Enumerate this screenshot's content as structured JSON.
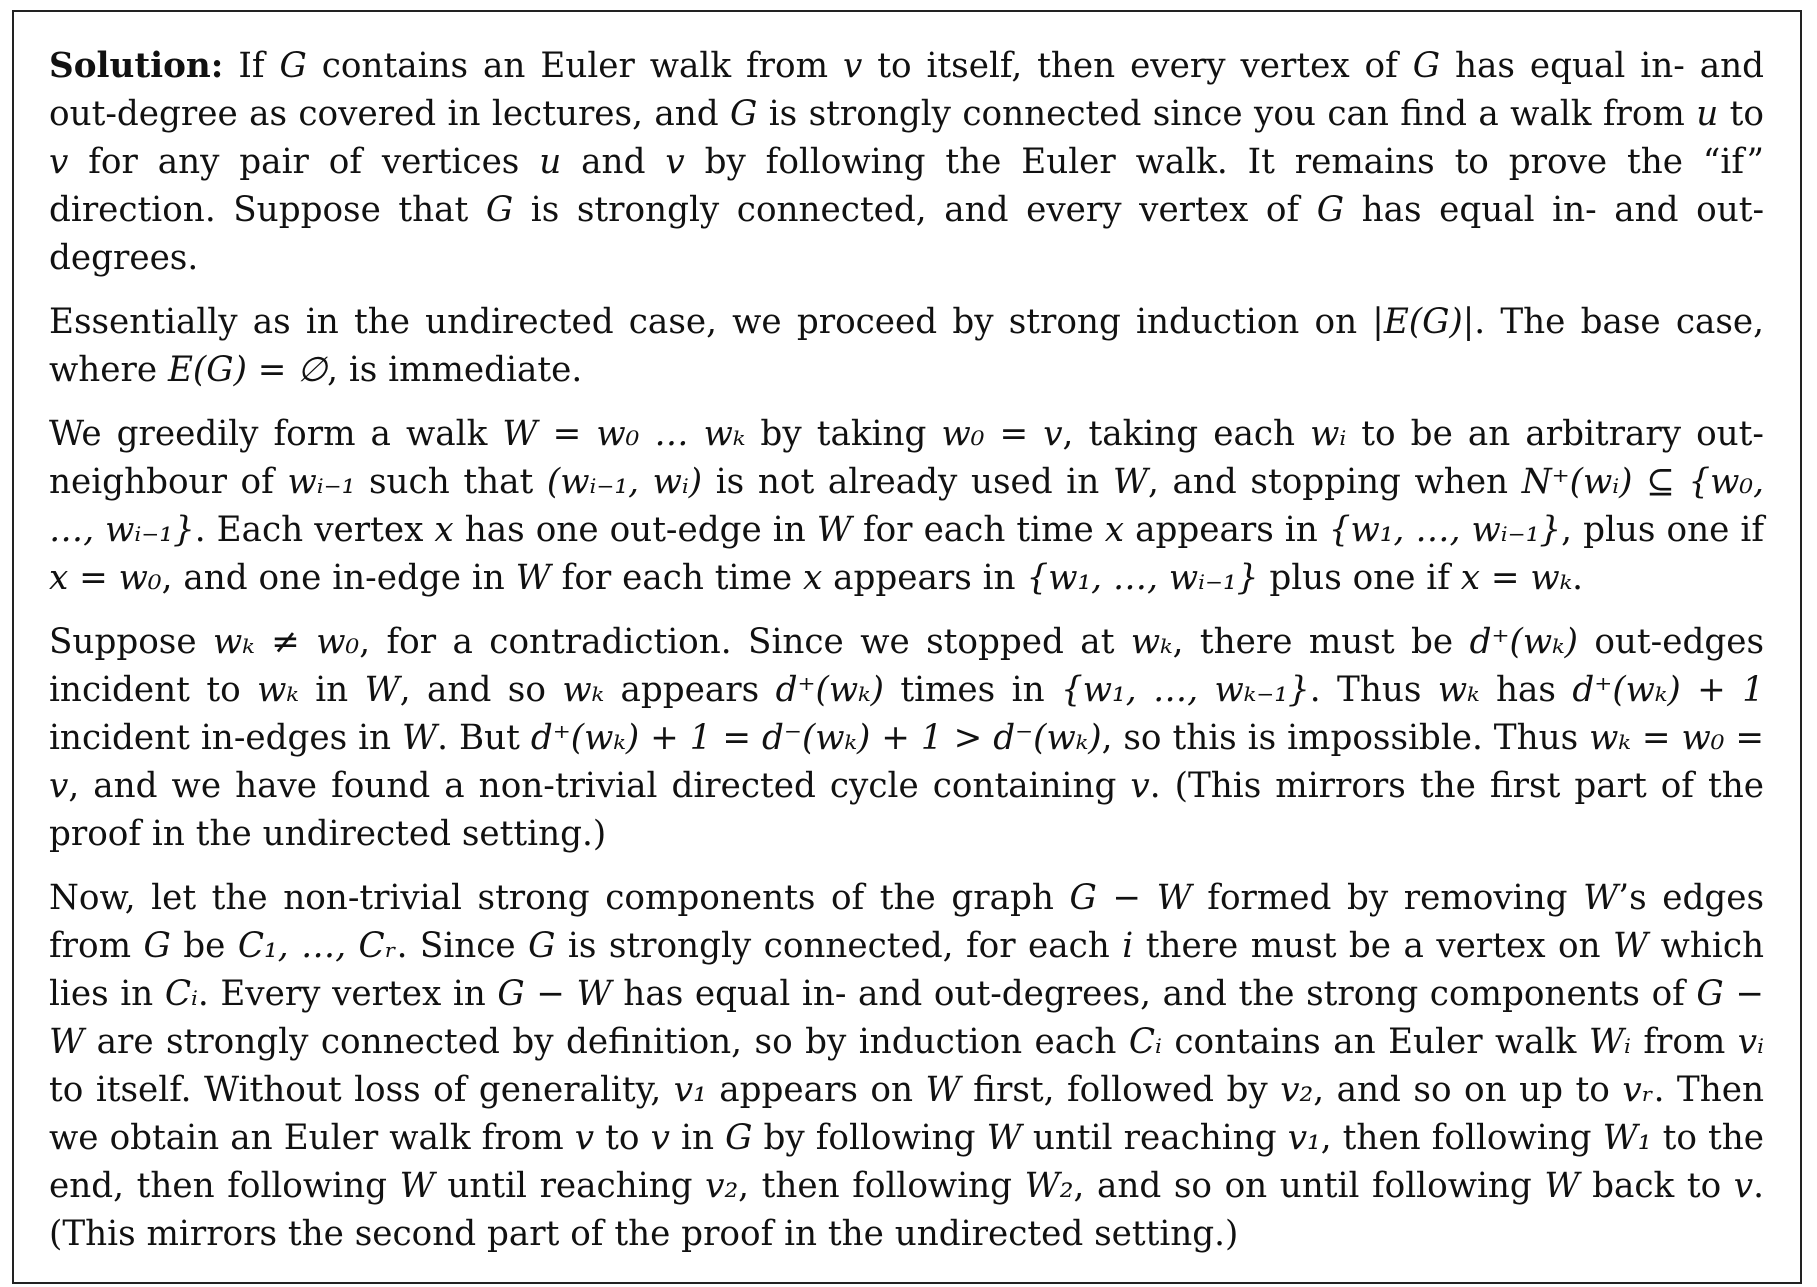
{
  "document": {
    "paragraphs": [
      {
        "segments": [
          {
            "text": "Solution:",
            "style": "bold"
          },
          {
            "text": " If ",
            "style": "normal"
          },
          {
            "text": "G",
            "style": "math"
          },
          {
            "text": " contains an Euler walk from ",
            "style": "normal"
          },
          {
            "text": "v",
            "style": "math"
          },
          {
            "text": " to itself, then every vertex of ",
            "style": "normal"
          },
          {
            "text": "G",
            "style": "math"
          },
          {
            "text": " has equal in- and out-degree as covered in lectures, and ",
            "style": "normal"
          },
          {
            "text": "G",
            "style": "math"
          },
          {
            "text": " is strongly connected since you can find a walk from ",
            "style": "normal"
          },
          {
            "text": "u",
            "style": "math"
          },
          {
            "text": " to ",
            "style": "normal"
          },
          {
            "text": "v",
            "style": "math"
          },
          {
            "text": " for any pair of vertices ",
            "style": "normal"
          },
          {
            "text": "u",
            "style": "math"
          },
          {
            "text": " and ",
            "style": "normal"
          },
          {
            "text": "v",
            "style": "math"
          },
          {
            "text": " by following the Euler walk. It remains to prove the “if” direction. Suppose that ",
            "style": "normal"
          },
          {
            "text": "G",
            "style": "math"
          },
          {
            "text": " is strongly connected, and every vertex of ",
            "style": "normal"
          },
          {
            "text": "G",
            "style": "math"
          },
          {
            "text": " has equal in- and out-degrees.",
            "style": "normal"
          }
        ]
      },
      {
        "segments": [
          {
            "text": "Essentially as in the undirected case, we proceed by strong induction on ",
            "style": "normal"
          },
          {
            "text": "|E(G)|",
            "style": "math"
          },
          {
            "text": ". The base case, where ",
            "style": "normal"
          },
          {
            "text": "E(G) = ∅",
            "style": "math"
          },
          {
            "text": ", is immediate.",
            "style": "normal"
          }
        ]
      },
      {
        "segments": [
          {
            "text": "We greedily form a walk ",
            "style": "normal"
          },
          {
            "text": "W = w₀ … wₖ",
            "style": "math"
          },
          {
            "text": " by taking ",
            "style": "normal"
          },
          {
            "text": "w₀ = v",
            "style": "math"
          },
          {
            "text": ", taking each ",
            "style": "normal"
          },
          {
            "text": "wᵢ",
            "style": "math"
          },
          {
            "text": " to be an arbitrary out-neighbour of ",
            "style": "normal"
          },
          {
            "text": "wᵢ₋₁",
            "style": "math"
          },
          {
            "text": " such that ",
            "style": "normal"
          },
          {
            "text": "(wᵢ₋₁, wᵢ)",
            "style": "math"
          },
          {
            "text": " is not already used in ",
            "style": "normal"
          },
          {
            "text": "W",
            "style": "math"
          },
          {
            "text": ", and stopping when ",
            "style": "normal"
          },
          {
            "text": "N⁺(wᵢ) ⊆ {w₀, …, wᵢ₋₁}",
            "style": "math"
          },
          {
            "text": ". Each vertex ",
            "style": "normal"
          },
          {
            "text": "x",
            "style": "math"
          },
          {
            "text": " has one out-edge in ",
            "style": "normal"
          },
          {
            "text": "W",
            "style": "math"
          },
          {
            "text": " for each time ",
            "style": "normal"
          },
          {
            "text": "x",
            "style": "math"
          },
          {
            "text": " appears in ",
            "style": "normal"
          },
          {
            "text": "{w₁, …, wᵢ₋₁}",
            "style": "math"
          },
          {
            "text": ", plus one if ",
            "style": "normal"
          },
          {
            "text": "x = w₀",
            "style": "math"
          },
          {
            "text": ", and one in-edge in ",
            "style": "normal"
          },
          {
            "text": "W",
            "style": "math"
          },
          {
            "text": " for each time ",
            "style": "normal"
          },
          {
            "text": "x",
            "style": "math"
          },
          {
            "text": " appears in ",
            "style": "normal"
          },
          {
            "text": "{w₁, …, wᵢ₋₁}",
            "style": "math"
          },
          {
            "text": " plus one if ",
            "style": "normal"
          },
          {
            "text": "x = wₖ",
            "style": "math"
          },
          {
            "text": ".",
            "style": "normal"
          }
        ]
      },
      {
        "segments": [
          {
            "text": "Suppose ",
            "style": "normal"
          },
          {
            "text": "wₖ ≠ w₀",
            "style": "math"
          },
          {
            "text": ", for a contradiction. Since we stopped at ",
            "style": "normal"
          },
          {
            "text": "wₖ",
            "style": "math"
          },
          {
            "text": ", there must be ",
            "style": "normal"
          },
          {
            "text": "d⁺(wₖ)",
            "style": "math"
          },
          {
            "text": " out-edges incident to ",
            "style": "normal"
          },
          {
            "text": "wₖ",
            "style": "math"
          },
          {
            "text": " in ",
            "style": "normal"
          },
          {
            "text": "W",
            "style": "math"
          },
          {
            "text": ", and so ",
            "style": "normal"
          },
          {
            "text": "wₖ",
            "style": "math"
          },
          {
            "text": " appears ",
            "style": "normal"
          },
          {
            "text": "d⁺(wₖ)",
            "style": "math"
          },
          {
            "text": " times in ",
            "style": "normal"
          },
          {
            "text": "{w₁, …, wₖ₋₁}",
            "style": "math"
          },
          {
            "text": ". Thus ",
            "style": "normal"
          },
          {
            "text": "wₖ",
            "style": "math"
          },
          {
            "text": " has ",
            "style": "normal"
          },
          {
            "text": "d⁺(wₖ) + 1",
            "style": "math"
          },
          {
            "text": " incident in-edges in ",
            "style": "normal"
          },
          {
            "text": "W",
            "style": "math"
          },
          {
            "text": ". But ",
            "style": "normal"
          },
          {
            "text": "d⁺(wₖ) + 1 = d⁻(wₖ) + 1 > d⁻(wₖ)",
            "style": "math"
          },
          {
            "text": ", so this is impossible. Thus ",
            "style": "normal"
          },
          {
            "text": "wₖ = w₀ = v",
            "style": "math"
          },
          {
            "text": ", and we have found a non-trivial directed cycle containing ",
            "style": "normal"
          },
          {
            "text": "v",
            "style": "math"
          },
          {
            "text": ". (This mirrors the first part of the proof in the undirected setting.)",
            "style": "normal"
          }
        ]
      },
      {
        "segments": [
          {
            "text": "Now, let the non-trivial strong components of the graph ",
            "style": "normal"
          },
          {
            "text": "G − W",
            "style": "math"
          },
          {
            "text": " formed by removing ",
            "style": "normal"
          },
          {
            "text": "W",
            "style": "math"
          },
          {
            "text": "’s edges from ",
            "style": "normal"
          },
          {
            "text": "G",
            "style": "math"
          },
          {
            "text": " be ",
            "style": "normal"
          },
          {
            "text": "C₁, …, Cᵣ",
            "style": "math"
          },
          {
            "text": ". Since ",
            "style": "normal"
          },
          {
            "text": "G",
            "style": "math"
          },
          {
            "text": " is strongly connected, for each ",
            "style": "normal"
          },
          {
            "text": "i",
            "style": "math"
          },
          {
            "text": " there must be a vertex on ",
            "style": "normal"
          },
          {
            "text": "W",
            "style": "math"
          },
          {
            "text": " which lies in ",
            "style": "normal"
          },
          {
            "text": "Cᵢ",
            "style": "math"
          },
          {
            "text": ". Every vertex in ",
            "style": "normal"
          },
          {
            "text": "G − W",
            "style": "math"
          },
          {
            "text": " has equal in- and out-degrees, and the strong components of ",
            "style": "normal"
          },
          {
            "text": "G − W",
            "style": "math"
          },
          {
            "text": " are strongly connected by definition, so by induction each ",
            "style": "normal"
          },
          {
            "text": "Cᵢ",
            "style": "math"
          },
          {
            "text": " contains an Euler walk ",
            "style": "normal"
          },
          {
            "text": "Wᵢ",
            "style": "math"
          },
          {
            "text": " from ",
            "style": "normal"
          },
          {
            "text": "vᵢ",
            "style": "math"
          },
          {
            "text": " to itself. Without loss of generality, ",
            "style": "normal"
          },
          {
            "text": "v₁",
            "style": "math"
          },
          {
            "text": " appears on ",
            "style": "normal"
          },
          {
            "text": "W",
            "style": "math"
          },
          {
            "text": " first, followed by ",
            "style": "normal"
          },
          {
            "text": "v₂",
            "style": "math"
          },
          {
            "text": ", and so on up to ",
            "style": "normal"
          },
          {
            "text": "vᵣ",
            "style": "math"
          },
          {
            "text": ". Then we obtain an Euler walk from ",
            "style": "normal"
          },
          {
            "text": "v",
            "style": "math"
          },
          {
            "text": " to ",
            "style": "normal"
          },
          {
            "text": "v",
            "style": "math"
          },
          {
            "text": " in ",
            "style": "normal"
          },
          {
            "text": "G",
            "style": "math"
          },
          {
            "text": " by following ",
            "style": "normal"
          },
          {
            "text": "W",
            "style": "math"
          },
          {
            "text": " until reaching ",
            "style": "normal"
          },
          {
            "text": "v₁",
            "style": "math"
          },
          {
            "text": ", then following ",
            "style": "normal"
          },
          {
            "text": "W₁",
            "style": "math"
          },
          {
            "text": " to the end, then following ",
            "style": "normal"
          },
          {
            "text": "W",
            "style": "math"
          },
          {
            "text": " until reaching ",
            "style": "normal"
          },
          {
            "text": "v₂",
            "style": "math"
          },
          {
            "text": ", then following ",
            "style": "normal"
          },
          {
            "text": "W₂",
            "style": "math"
          },
          {
            "text": ", and so on until following ",
            "style": "normal"
          },
          {
            "text": "W",
            "style": "math"
          },
          {
            "text": " back to ",
            "style": "normal"
          },
          {
            "text": "v",
            "style": "math"
          },
          {
            "text": ". (This mirrors the second part of the proof in the undirected setting.)",
            "style": "normal"
          }
        ]
      }
    ]
  }
}
